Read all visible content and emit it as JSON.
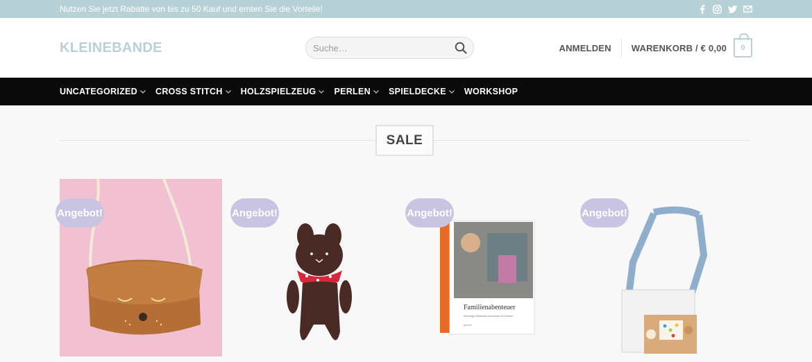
{
  "topbar": {
    "promo": "Nutzen Sie jetzt Rabatte von bis zu 50 Kauf und ernten Sie die Vorteile!",
    "social": [
      "facebook-icon",
      "instagram-icon",
      "twitter-icon",
      "email-icon"
    ]
  },
  "header": {
    "logo": "KLEINEBANDE",
    "search_placeholder": "Suche…",
    "login": "ANMELDEN",
    "cart_label": "WARENKORB / € 0,00",
    "cart_count": "0"
  },
  "nav": {
    "items": [
      {
        "label": "UNCATEGORIZED",
        "dropdown": true
      },
      {
        "label": "CROSS STITCH",
        "dropdown": true
      },
      {
        "label": "HOLZSPIELZEUG",
        "dropdown": true
      },
      {
        "label": "PERLEN",
        "dropdown": true
      },
      {
        "label": "SPIELDECKE",
        "dropdown": true
      },
      {
        "label": "WORKSHOP",
        "dropdown": false
      }
    ]
  },
  "section": {
    "title": "SALE"
  },
  "products": [
    {
      "badge": "Angebot!",
      "image": "cat-bag"
    },
    {
      "badge": "Angebot!",
      "image": "teddy-bear"
    },
    {
      "badge": "Angebot!",
      "image": "book"
    },
    {
      "badge": "Angebot!",
      "image": "shoulder-bag"
    }
  ],
  "book": {
    "title": "Familienabenteuer",
    "subtitle": "Einmalige Erlebnisse und Urlaub mit Kindern",
    "author": "geklebt"
  },
  "colors": {
    "accent": "#b8d1d6",
    "badge": "#c8c4e2",
    "nav_bg": "#0a0a0a"
  }
}
